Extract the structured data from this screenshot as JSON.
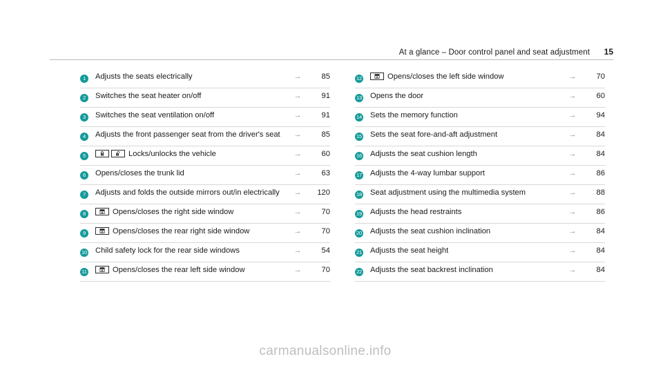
{
  "header": {
    "title": "At a glance – Door control panel and seat adjustment",
    "page_number": "15",
    "arrow_symbol": "→"
  },
  "watermark": {
    "text": "carmanualsonline.info"
  },
  "colors": {
    "badge_teal": "#139a9a",
    "rule": "#b9b9b9",
    "row_divider": "#d8d8d8",
    "arrow": "#8a8a8a",
    "watermark": "#bfbfbf",
    "text": "#1a1a1a"
  },
  "left_column": {
    "rows": [
      {
        "num": "1",
        "icons": [],
        "text": "Adjusts the seats electrically",
        "arrow": "→",
        "page": "85"
      },
      {
        "num": "2",
        "icons": [],
        "text": "Switches the seat heater on/off",
        "arrow": "→",
        "page": "91"
      },
      {
        "num": "3",
        "icons": [],
        "text": "Switches the seat ventilation on/off",
        "arrow": "→",
        "page": "91"
      },
      {
        "num": "4",
        "icons": [],
        "text": "Adjusts the front passenger seat from the driver's seat",
        "arrow": "→",
        "page": "85"
      },
      {
        "num": "5",
        "icons": [
          "lock-closed-icon",
          "lock-open-icon"
        ],
        "text": "Locks/unlocks the vehicle",
        "arrow": "→",
        "page": "60"
      },
      {
        "num": "6",
        "icons": [],
        "text": "Opens/closes the trunk lid",
        "arrow": "→",
        "page": "63"
      },
      {
        "num": "7",
        "icons": [],
        "text": "Adjusts and folds the outside mirrors out/in electrically",
        "arrow": "→",
        "page": "120"
      },
      {
        "num": "8",
        "icons": [
          "window-icon"
        ],
        "text": "Opens/closes the right side window",
        "arrow": "→",
        "page": "70"
      },
      {
        "num": "9",
        "icons": [
          "window-icon"
        ],
        "text": "Opens/closes the rear right side window",
        "arrow": "→",
        "page": "70"
      },
      {
        "num": "10",
        "icons": [],
        "text": "Child safety lock for the rear side windows",
        "arrow": "→",
        "page": "54"
      },
      {
        "num": "11",
        "icons": [
          "window-icon"
        ],
        "text": "Opens/closes the rear left side window",
        "arrow": "→",
        "page": "70"
      }
    ]
  },
  "right_column": {
    "rows": [
      {
        "num": "12",
        "icons": [
          "window-icon"
        ],
        "text": "Opens/closes the left side window",
        "arrow": "→",
        "page": "70"
      },
      {
        "num": "13",
        "icons": [],
        "text": "Opens the door",
        "arrow": "→",
        "page": "60"
      },
      {
        "num": "14",
        "icons": [],
        "text": "Sets the memory function",
        "arrow": "→",
        "page": "94"
      },
      {
        "num": "15",
        "icons": [],
        "text": "Sets the seat fore-and-aft adjustment",
        "arrow": "→",
        "page": "84"
      },
      {
        "num": "16",
        "icons": [],
        "text": "Adjusts the seat cushion length",
        "arrow": "→",
        "page": "84"
      },
      {
        "num": "17",
        "icons": [],
        "text": "Adjusts the 4-way lumbar support",
        "arrow": "→",
        "page": "86"
      },
      {
        "num": "18",
        "icons": [],
        "text": "Seat adjustment using the multimedia system",
        "arrow": "→",
        "page": "88"
      },
      {
        "num": "19",
        "icons": [],
        "text": "Adjusts the head restraints",
        "arrow": "→",
        "page": "86"
      },
      {
        "num": "20",
        "icons": [],
        "text": "Adjusts the seat cushion inclination",
        "arrow": "→",
        "page": "84"
      },
      {
        "num": "21",
        "icons": [],
        "text": "Adjusts the seat height",
        "arrow": "→",
        "page": "84"
      },
      {
        "num": "22",
        "icons": [],
        "text": "Adjusts the seat backrest inclination",
        "arrow": "→",
        "page": "84"
      }
    ]
  }
}
